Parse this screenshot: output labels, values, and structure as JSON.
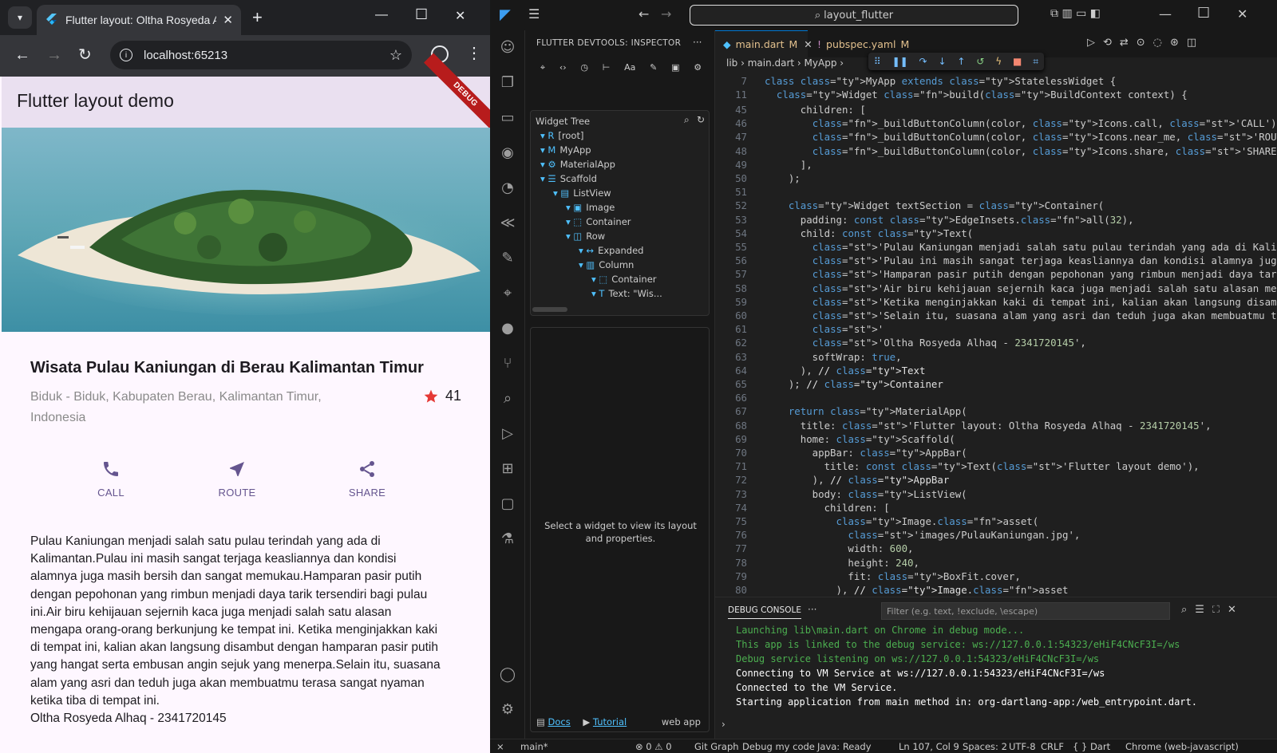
{
  "chrome": {
    "tab_title": "Flutter layout: Oltha Rosyeda Al",
    "url": "localhost:65213"
  },
  "app": {
    "appbar_title": "Flutter layout demo",
    "debug_banner": "DEBUG",
    "heading": "Wisata Pulau Kaniungan di Berau Kalimantan Timur",
    "subtitle": "Biduk - Biduk, Kabupaten Berau, Kalimantan Timur, Indonesia",
    "rating": "41",
    "buttons": [
      {
        "label": "CALL",
        "icon": "phone-icon"
      },
      {
        "label": "ROUTE",
        "icon": "near-me-icon"
      },
      {
        "label": "SHARE",
        "icon": "share-icon"
      }
    ],
    "body_lines": [
      "Pulau Kaniungan menjadi salah satu pulau terindah yang ada di",
      "Kalimantan.Pulau ini masih sangat terjaga keasliannya dan kondisi",
      "alamnya juga masih bersih dan sangat memukau.Hamparan pasir putih",
      "dengan pepohonan yang rimbun menjadi daya tarik tersendiri bagi pulau",
      "ini.Air biru kehijauan sejernih kaca juga menjadi salah satu alasan",
      "mengapa orang-orang berkunjung ke tempat ini. Ketika menginjakkan kaki",
      "di tempat ini, kalian akan langsung disambut dengan hamparan pasir putih",
      "yang hangat serta embusan angin sejuk yang menerpa.Selain itu, suasana",
      "alam yang asri dan teduh juga akan membuatmu terasa sangat nyaman",
      "ketika tiba di tempat ini.",
      "Oltha Rosyeda Alhaq - 2341720145"
    ]
  },
  "vscode": {
    "command_center": "layout_flutter",
    "devtools_title": "FLUTTER DEVTOOLS: INSPECTOR",
    "widget_tree_label": "Widget Tree",
    "tree": [
      {
        "label": "[root]",
        "depth": 0,
        "icon": "R"
      },
      {
        "label": "MyApp",
        "depth": 0,
        "icon": "M"
      },
      {
        "label": "MaterialApp",
        "depth": 0,
        "icon": "⚙"
      },
      {
        "label": "Scaffold",
        "depth": 0,
        "icon": "☰"
      },
      {
        "label": "ListView",
        "depth": 1,
        "icon": "▤"
      },
      {
        "label": "Image",
        "depth": 2,
        "icon": "▣"
      },
      {
        "label": "Container",
        "depth": 2,
        "icon": "⬚"
      },
      {
        "label": "Row",
        "depth": 2,
        "icon": "◫"
      },
      {
        "label": "Expanded",
        "depth": 3,
        "icon": "↔"
      },
      {
        "label": "Column",
        "depth": 3,
        "icon": "▥"
      },
      {
        "label": "Container",
        "depth": 4,
        "icon": "⬚"
      },
      {
        "label": "Text: \"Wis...",
        "depth": 4,
        "icon": "T"
      }
    ],
    "props_message": "Select a widget to view its layout and properties.",
    "footer_docs": "Docs",
    "footer_tutorial": "Tutorial",
    "footer_app": "web app",
    "tabs": [
      {
        "label": "main.dart",
        "badge": "M"
      },
      {
        "label": "pubspec.yaml",
        "badge": "M"
      }
    ],
    "breadcrumb": "lib  ›  main.dart  ›  MyApp  ›",
    "sticky": [
      {
        "n": "7",
        "text": "class MyApp extends StatelessWidget {"
      },
      {
        "n": "11",
        "text": "  Widget build(BuildContext context) {"
      }
    ],
    "code_lines": [
      {
        "n": "45",
        "text": "      children: ["
      },
      {
        "n": "46",
        "text": "        _buildButtonColumn(color, Icons.call, 'CALL'),"
      },
      {
        "n": "47",
        "text": "        _buildButtonColumn(color, Icons.near_me, 'ROUTE'),"
      },
      {
        "n": "48",
        "text": "        _buildButtonColumn(color, Icons.share, 'SHARE'),"
      },
      {
        "n": "49",
        "text": "      ],"
      },
      {
        "n": "50",
        "text": "    );"
      },
      {
        "n": "51",
        "text": ""
      },
      {
        "n": "52",
        "text": "    Widget textSection = Container("
      },
      {
        "n": "53",
        "text": "      padding: const EdgeInsets.all(32),"
      },
      {
        "n": "54",
        "text": "      child: const Text("
      },
      {
        "n": "55",
        "text": "        'Pulau Kaniungan menjadi salah satu pulau terindah yang ada di Kalimantan.'"
      },
      {
        "n": "56",
        "text": "        'Pulau ini masih sangat terjaga keasliannya dan kondisi alamnya juga masih bersih"
      },
      {
        "n": "57",
        "text": "        'Hamparan pasir putih dengan pepohonan yang rimbun menjadi daya tarik tersendiri"
      },
      {
        "n": "58",
        "text": "        'Air biru kehijauan sejernih kaca juga menjadi salah satu alasan mengapa orang-ora"
      },
      {
        "n": "59",
        "text": "        'Ketika menginjakkan kaki di tempat ini, kalian akan langsung disambut dengan ham"
      },
      {
        "n": "60",
        "text": "        'Selain itu, suasana alam yang asri dan teduh juga akan membuatmu terasa sangat n"
      },
      {
        "n": "61",
        "text": "        '"
      },
      {
        "n": "62",
        "text": "        'Oltha Rosyeda Alhaq - 2341720145',"
      },
      {
        "n": "63",
        "text": "        softWrap: true,"
      },
      {
        "n": "64",
        "text": "      ), // Text"
      },
      {
        "n": "65",
        "text": "    ); // Container"
      },
      {
        "n": "66",
        "text": ""
      },
      {
        "n": "67",
        "text": "    return MaterialApp("
      },
      {
        "n": "68",
        "text": "      title: 'Flutter layout: Oltha Rosyeda Alhaq - 2341720145',"
      },
      {
        "n": "69",
        "text": "      home: Scaffold("
      },
      {
        "n": "70",
        "text": "        appBar: AppBar("
      },
      {
        "n": "71",
        "text": "          title: const Text('Flutter layout demo'),"
      },
      {
        "n": "72",
        "text": "        ), // AppBar"
      },
      {
        "n": "73",
        "text": "        body: ListView("
      },
      {
        "n": "74",
        "text": "          children: ["
      },
      {
        "n": "75",
        "text": "            Image.asset("
      },
      {
        "n": "76",
        "text": "              'images/PulauKaniungan.jpg',"
      },
      {
        "n": "77",
        "text": "              width: 600,"
      },
      {
        "n": "78",
        "text": "              height: 240,"
      },
      {
        "n": "79",
        "text": "              fit: BoxFit.cover,"
      },
      {
        "n": "80",
        "text": "            ), // Image.asset"
      }
    ],
    "panel_tab": "DEBUG CONSOLE",
    "filter_placeholder": "Filter (e.g. text, !exclude, \\escape)",
    "console": [
      {
        "text": "Launching lib\\main.dart on Chrome in debug mode...",
        "color": "#4caf50"
      },
      {
        "text": "This app is linked to the debug service: ws://127.0.0.1:54323/eHiF4CNcF3I=/ws",
        "color": "#4caf50"
      },
      {
        "text": "Debug service listening on ws://127.0.0.1:54323/eHiF4CNcF3I=/ws",
        "color": "#4caf50"
      },
      {
        "text": "Connecting to VM Service at ws://127.0.0.1:54323/eHiF4CNcF3I=/ws",
        "color": "#ffffff"
      },
      {
        "text": "Connected to the VM Service.",
        "color": "#ffffff"
      },
      {
        "text": "Starting application from main method in: org-dartlang-app:/web_entrypoint.dart.",
        "color": "#ffffff"
      }
    ],
    "status": {
      "branch": "main*",
      "problems": "⊗ 0 ⚠ 0",
      "git_graph": "Git Graph",
      "debug": "Debug my code",
      "java": "Java: Ready",
      "position": "Ln 107, Col 9",
      "spaces": "Spaces: 2",
      "encoding": "UTF-8",
      "eol": "CRLF",
      "language": "{ } Dart",
      "device": "Chrome (web-javascript)"
    }
  }
}
